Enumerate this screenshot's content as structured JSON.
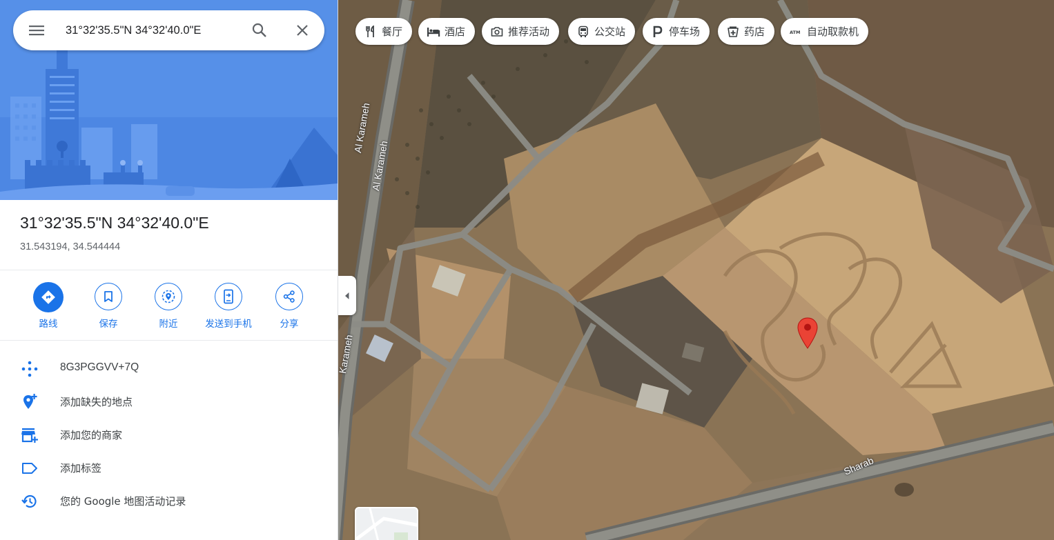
{
  "search": {
    "value": "31°32'35.5\"N 34°32'40.0\"E",
    "placeholder": ""
  },
  "icons": {
    "menu": "menu-icon",
    "search": "search-icon",
    "close": "close-icon"
  },
  "place": {
    "title": "31°32'35.5\"N 34°32'40.0\"E",
    "decimal": "31.543194, 34.544444"
  },
  "actions": [
    {
      "label": "路线",
      "icon": "directions-icon"
    },
    {
      "label": "保存",
      "icon": "bookmark-icon"
    },
    {
      "label": "附近",
      "icon": "nearby-icon"
    },
    {
      "label": "发送到手机",
      "icon": "send-to-phone-icon"
    },
    {
      "label": "分享",
      "icon": "share-icon"
    }
  ],
  "info": {
    "plus_code": "8G3PGGVV+7Q",
    "add_place": "添加缺失的地点",
    "add_business": "添加您的商家",
    "add_label": "添加标签",
    "activity": "您的 Google 地图活动记录"
  },
  "chips": [
    {
      "label": "餐厅",
      "icon": "restaurant-icon"
    },
    {
      "label": "酒店",
      "icon": "hotel-icon"
    },
    {
      "label": "推荐活动",
      "icon": "camera-icon"
    },
    {
      "label": "公交站",
      "icon": "transit-icon"
    },
    {
      "label": "停车场",
      "icon": "parking-icon"
    },
    {
      "label": "药店",
      "icon": "pharmacy-icon"
    },
    {
      "label": "自动取款机",
      "icon": "atm-icon"
    }
  ],
  "map": {
    "road_labels": [
      "Al Karameh",
      "Al Karameh",
      "Sharab",
      "Karameh"
    ]
  },
  "colors": {
    "accent": "#1a73e8",
    "hero": "#4a86e8",
    "pin": "#ea4335"
  }
}
